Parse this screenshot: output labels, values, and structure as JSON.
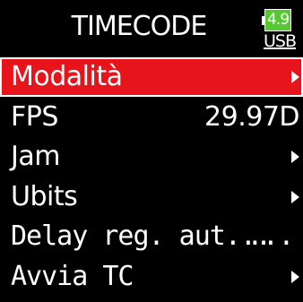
{
  "header": {
    "title": "TIMECODE",
    "battery_value": "4.9",
    "power_source": "USB"
  },
  "menu": {
    "items": [
      {
        "label": "Modalità",
        "value": null,
        "has_arrow": true,
        "selected": true
      },
      {
        "label": "FPS",
        "value": "29.97D",
        "has_arrow": false,
        "selected": false
      },
      {
        "label": "Jam",
        "value": null,
        "has_arrow": true,
        "selected": false
      },
      {
        "label": "Ubits",
        "value": null,
        "has_arrow": true,
        "selected": false
      },
      {
        "label": "Delay reg. aut...",
        "value": "...",
        "has_arrow": false,
        "selected": false
      },
      {
        "label": "Avvia TC",
        "value": null,
        "has_arrow": true,
        "selected": false
      }
    ]
  },
  "colors": {
    "selection": "#e8141c",
    "battery": "#56c832"
  },
  "icons": {
    "battery": "battery-icon",
    "arrow": "chevron-right-icon"
  }
}
